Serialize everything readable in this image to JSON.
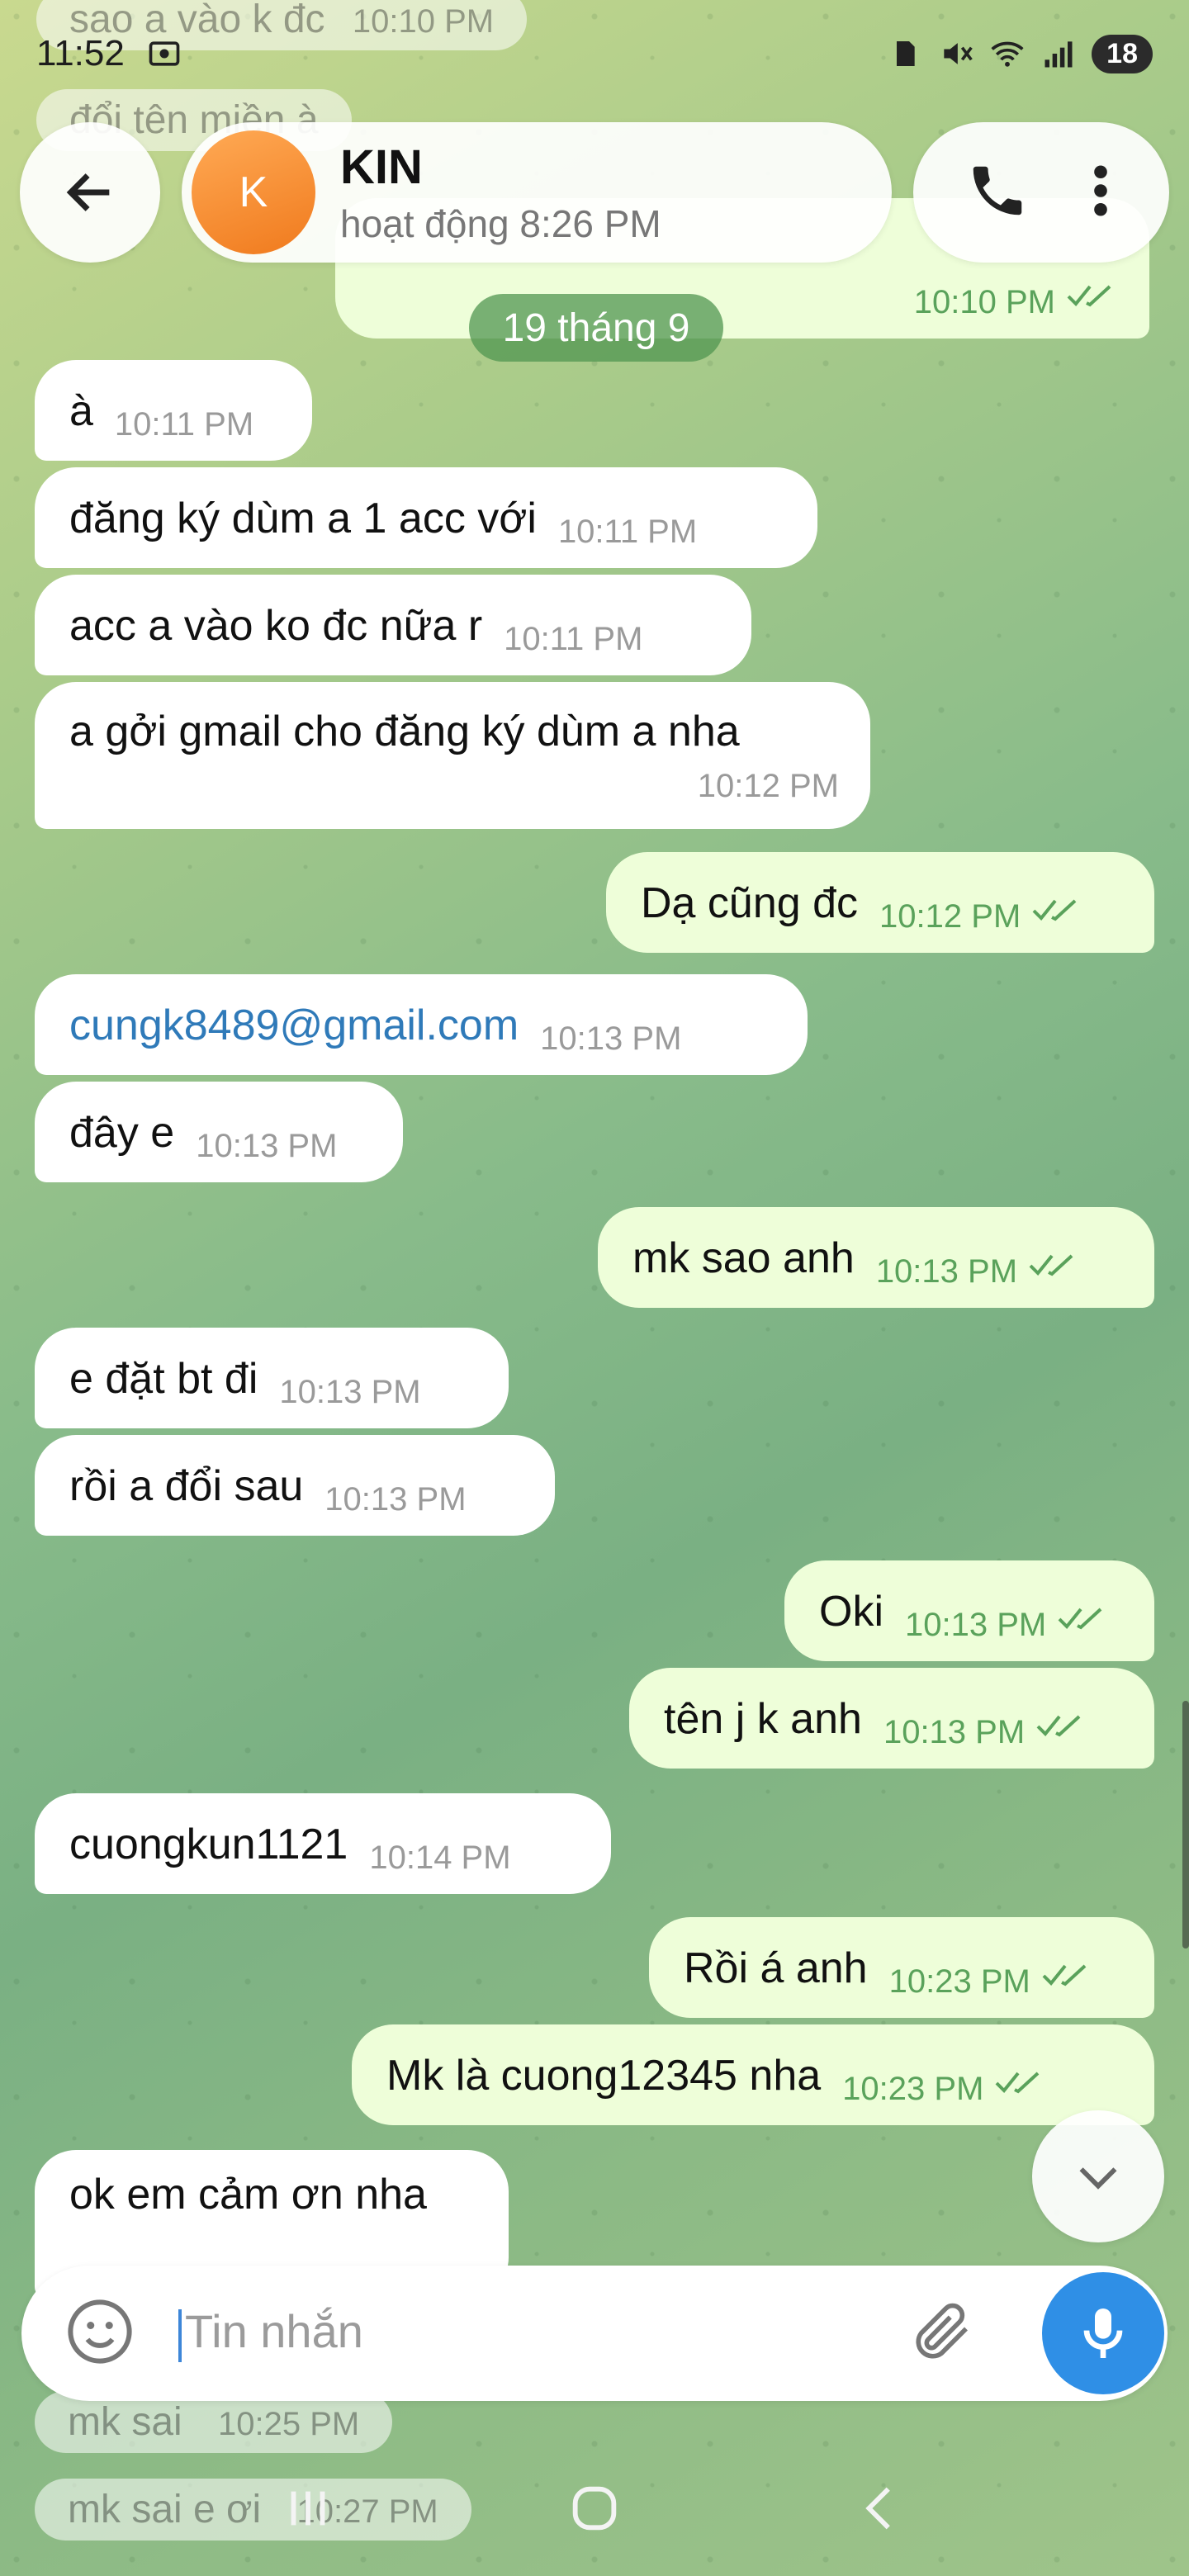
{
  "status_bar": {
    "time": "11:52",
    "battery": "18"
  },
  "ghost_messages": [
    {
      "text": "sao a vào k đc",
      "time": "10:10 PM"
    },
    {
      "text": "đổi tên miền à"
    }
  ],
  "header": {
    "avatar_letter": "K",
    "contact_name": "KIN",
    "contact_status": "hoạt động 8:26 PM"
  },
  "first_out_time": "10:10 PM",
  "date_chip": "19 tháng 9",
  "messages": [
    {
      "dir": "in",
      "text": "à",
      "time": "10:11 PM"
    },
    {
      "dir": "in",
      "text": "đăng ký dùm a 1 acc với",
      "time": "10:11 PM"
    },
    {
      "dir": "in",
      "text": "acc a vào ko đc nữa r",
      "time": "10:11 PM"
    },
    {
      "dir": "in",
      "text": "a gởi gmail cho đăng ký dùm a nha",
      "time": "10:12 PM"
    },
    {
      "dir": "out",
      "text": "Dạ cũng đc",
      "time": "10:12 PM"
    },
    {
      "dir": "in",
      "text": "cungk8489@gmail.com",
      "time": "10:13 PM",
      "link": true
    },
    {
      "dir": "in",
      "text": "đây e",
      "time": "10:13 PM"
    },
    {
      "dir": "out",
      "text": "mk sao anh",
      "time": "10:13 PM"
    },
    {
      "dir": "in",
      "text": "e đặt bt đi",
      "time": "10:13 PM"
    },
    {
      "dir": "in",
      "text": "rồi a đổi sau",
      "time": "10:13 PM"
    },
    {
      "dir": "out",
      "text": "Oki",
      "time": "10:13 PM"
    },
    {
      "dir": "out",
      "text": "tên j k anh",
      "time": "10:13 PM"
    },
    {
      "dir": "in",
      "text": "cuongkun1121",
      "time": "10:14 PM"
    },
    {
      "dir": "out",
      "text": "Rồi á anh",
      "time": "10:23 PM"
    },
    {
      "dir": "out",
      "text": "Mk là cuong12345 nha",
      "time": "10:23 PM"
    },
    {
      "dir": "in",
      "text": "ok em cảm ơn nha"
    }
  ],
  "hidden_messages": [
    {
      "text": "mk sai",
      "time": "10:25 PM"
    },
    {
      "text": "mk sai e ơi",
      "time": "10:27 PM"
    }
  ],
  "input": {
    "placeholder": "Tin nhắn"
  },
  "colors": {
    "accent": "#2f8fe6",
    "outgoing_bubble": "#eefed9",
    "tick": "#5aa25b",
    "avatar": "#f07a1d"
  },
  "icons": [
    "back-arrow-icon",
    "phone-icon",
    "more-vertical-icon",
    "emoji-icon",
    "attach-icon",
    "mic-icon",
    "chevron-down-icon"
  ]
}
